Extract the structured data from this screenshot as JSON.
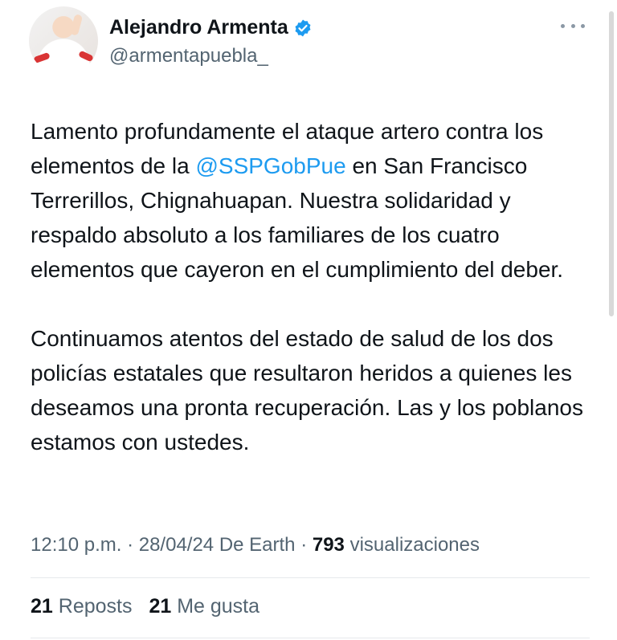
{
  "author": {
    "display_name": "Alejandro Armenta",
    "handle": "@armentapuebla_",
    "verified_icon": "verified-badge-icon",
    "avatar_icon": "profile-photo"
  },
  "tweet": {
    "p1_before": "Lamento profundamente el ataque artero contra los elementos de la ",
    "p1_mention": "@SSPGobPue",
    "p1_after": " en San Francisco Terrerillos, Chignahuapan. Nuestra solidaridad y respaldo absoluto a los familiares de los cuatro elementos que cayeron en el cumplimiento del deber.",
    "p2": "Continuamos atentos del estado de salud de los dos policías estatales que resultaron heridos a quienes les deseamos una pronta recuperación. Las y los poblanos estamos con ustedes."
  },
  "meta": {
    "time_date_source": "12:10 p.m. · 28/04/24 De Earth · ",
    "views_count": "793",
    "views_label": "visualizaciones"
  },
  "stats": {
    "reposts_count": "21",
    "reposts_label": "Reposts",
    "likes_count": "21",
    "likes_label": "Me gusta"
  },
  "colors": {
    "mention": "#1d9bf0",
    "verified": "#1d9bf0",
    "secondary_text": "#536471"
  }
}
